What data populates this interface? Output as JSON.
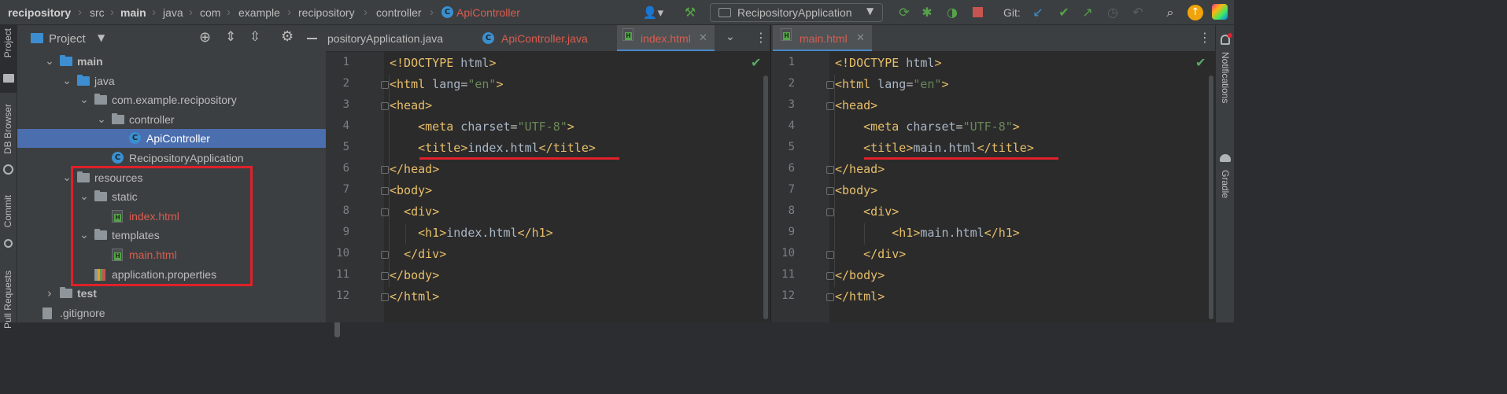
{
  "breadcrumb": {
    "items": [
      "recipository",
      "src",
      "main",
      "java",
      "com",
      "example",
      "recipository",
      "controller",
      "ApiController"
    ]
  },
  "toolbar": {
    "run_config": "RecipositoryApplication",
    "vcs_label": "Git:",
    "icons": [
      "user-icon",
      "hammer-icon",
      "rerun-icon",
      "debug-icon",
      "coverage-icon",
      "stop-icon",
      "update-icon",
      "commit-icon",
      "push-icon",
      "history-icon",
      "rollback-icon",
      "search-icon",
      "update-available-icon",
      "jetbrains-logo-icon"
    ]
  },
  "left_strip": {
    "items": [
      "Project",
      "DB Browser",
      "Commit",
      "Pull Requests"
    ]
  },
  "right_strip": {
    "items": [
      "Notifications",
      "Gradle"
    ]
  },
  "project_panel": {
    "title": "Project",
    "tree": [
      {
        "label": "main",
        "type": "folder-blue",
        "level": 3,
        "expanded": true
      },
      {
        "label": "java",
        "type": "folder-blue",
        "level": 4,
        "expanded": true
      },
      {
        "label": "com.example.recipository",
        "type": "package",
        "level": 5,
        "expanded": true
      },
      {
        "label": "controller",
        "type": "folder",
        "level": 6,
        "expanded": true
      },
      {
        "label": "ApiController",
        "type": "class",
        "level": 7,
        "selected": true
      },
      {
        "label": "RecipositoryApplication",
        "type": "class",
        "level": 6
      },
      {
        "label": "resources",
        "type": "folder",
        "level": 4,
        "expanded": true
      },
      {
        "label": "static",
        "type": "folder",
        "level": 5,
        "expanded": true
      },
      {
        "label": "index.html",
        "type": "html",
        "level": 6
      },
      {
        "label": "templates",
        "type": "folder",
        "level": 5,
        "expanded": true
      },
      {
        "label": "main.html",
        "type": "html",
        "level": 6
      },
      {
        "label": "application.properties",
        "type": "properties",
        "level": 5
      },
      {
        "label": "test",
        "type": "folder",
        "level": 3,
        "expanded": false
      },
      {
        "label": ".gitignore",
        "type": "file",
        "level": 2
      }
    ]
  },
  "editor_left": {
    "tabs": [
      {
        "label": "positoryApplication.java",
        "active": false
      },
      {
        "label": "ApiController.java",
        "active": false
      },
      {
        "label": "index.html",
        "active": true
      }
    ],
    "lines": [
      "1",
      "2",
      "3",
      "4",
      "5",
      "6",
      "7",
      "8",
      "9",
      "10",
      "11",
      "12"
    ],
    "code": [
      "<!DOCTYPE html>",
      "<html lang=\"en\">",
      "<head>",
      "    <meta charset=\"UTF-8\">",
      "    <title>index.html</title>",
      "</head>",
      "<body>",
      "  <div>",
      "    <h1>index.html</h1>",
      "  </div>",
      "</body>",
      "</html>"
    ]
  },
  "editor_right": {
    "tabs": [
      {
        "label": "main.html",
        "active": true
      }
    ],
    "lines": [
      "1",
      "2",
      "3",
      "4",
      "5",
      "6",
      "7",
      "8",
      "9",
      "10",
      "11",
      "12"
    ],
    "code": [
      "<!DOCTYPE html>",
      "<html lang=\"en\">",
      "<head>",
      "    <meta charset=\"UTF-8\">",
      "    <title>main.html</title>",
      "</head>",
      "<body>",
      "    <div>",
      "        <h1>main.html</h1>",
      "    </div>",
      "</body>",
      "</html>"
    ]
  },
  "colors": {
    "highlight": "#e0202a",
    "selection": "#4b6eaf",
    "accent_tab": "#4a88c7",
    "html_file": "#d95c4f"
  }
}
